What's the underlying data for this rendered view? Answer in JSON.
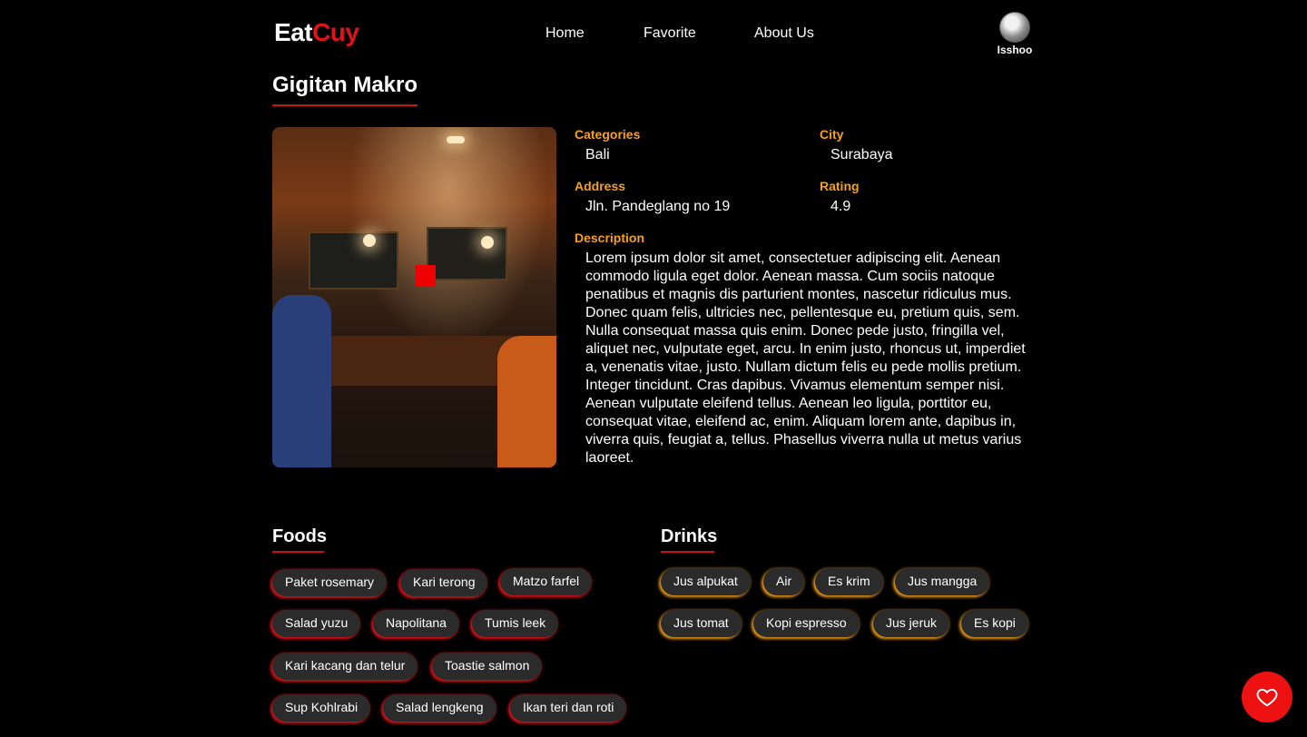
{
  "header": {
    "brand_eat": "Eat",
    "brand_cuy": "Cuy",
    "nav": [
      "Home",
      "Favorite",
      "About Us"
    ],
    "user_name": "Isshoo"
  },
  "restaurant": {
    "name": "Gigitan Makro",
    "fields": {
      "categories": {
        "label": "Categories",
        "value": "Bali"
      },
      "city": {
        "label": "City",
        "value": "Surabaya"
      },
      "address": {
        "label": "Address",
        "value": "Jln. Pandeglang no 19"
      },
      "rating": {
        "label": "Rating",
        "value": "4.9"
      },
      "description": {
        "label": "Description",
        "value": "Lorem ipsum dolor sit amet, consectetuer adipiscing elit. Aenean commodo ligula eget dolor. Aenean massa. Cum sociis natoque penatibus et magnis dis parturient montes, nascetur ridiculus mus. Donec quam felis, ultricies nec, pellentesque eu, pretium quis, sem. Nulla consequat massa quis enim. Donec pede justo, fringilla vel, aliquet nec, vulputate eget, arcu. In enim justo, rhoncus ut, imperdiet a, venenatis vitae, justo. Nullam dictum felis eu pede mollis pretium. Integer tincidunt. Cras dapibus. Vivamus elementum semper nisi. Aenean vulputate eleifend tellus. Aenean leo ligula, porttitor eu, consequat vitae, eleifend ac, enim. Aliquam lorem ante, dapibus in, viverra quis, feugiat a, tellus. Phasellus viverra nulla ut metus varius laoreet."
      }
    }
  },
  "foods": {
    "title": "Foods",
    "items": [
      "Paket rosemary",
      "Kari terong",
      "Matzo farfel",
      "Salad yuzu",
      "Napolitana",
      "Tumis leek",
      "Kari kacang dan telur",
      "Toastie salmon",
      "Sup Kohlrabi",
      "Salad lengkeng",
      "Ikan teri dan roti"
    ]
  },
  "drinks": {
    "title": "Drinks",
    "items": [
      "Jus alpukat",
      "Air",
      "Es krim",
      "Jus mangga",
      "Jus tomat",
      "Kopi espresso",
      "Jus jeruk",
      "Es kopi"
    ]
  },
  "colors": {
    "background": "#000000",
    "brand_red": "#e0121b",
    "label_orange": "#f5a11c",
    "fab_red": "#ed1111"
  },
  "icons": {
    "fab": "heart-outline-icon",
    "avatar": "user-avatar"
  }
}
